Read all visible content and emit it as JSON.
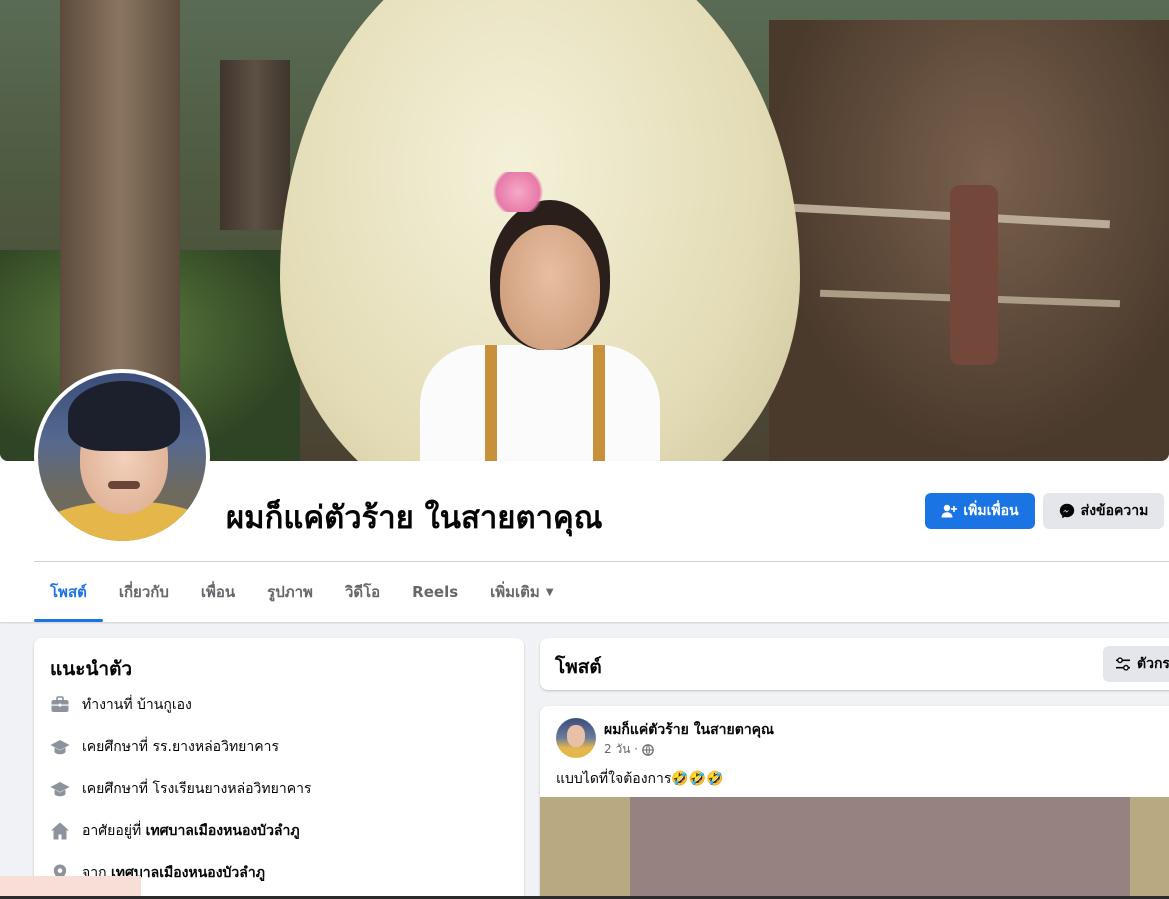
{
  "profile": {
    "name": "ผมก็แค่ตัวร้าย ในสายตาคุณ"
  },
  "actions": {
    "add_friend": "เพิ่มเพื่อน",
    "message": "ส่งข้อความ"
  },
  "tabs": [
    {
      "label": "โพสต์",
      "active": true
    },
    {
      "label": "เกี่ยวกับ"
    },
    {
      "label": "เพื่อน"
    },
    {
      "label": "รูปภาพ"
    },
    {
      "label": "วิดีโอ"
    },
    {
      "label": "Reels"
    },
    {
      "label": "เพิ่มเติม"
    }
  ],
  "intro": {
    "title": "แนะนำตัว",
    "items": [
      {
        "icon": "briefcase-icon",
        "prefix": "ทำงานที่ บ้านกูเอง",
        "bold": ""
      },
      {
        "icon": "graduation-cap-icon",
        "prefix": "เคยศึกษาที่ รร.ยางหล่อวิทยาคาร",
        "bold": ""
      },
      {
        "icon": "graduation-cap-icon",
        "prefix": "เคยศึกษาที่ โรงเรียนยางหล่อวิทยาคาร",
        "bold": ""
      },
      {
        "icon": "home-icon",
        "prefix": "อาศัยอยู่ที่ ",
        "bold": "เทศบาลเมืองหนองบัวลำภู"
      },
      {
        "icon": "location-pin-icon",
        "prefix": "จาก ",
        "bold": "เทศบาลเมืองหนองบัวลำภู"
      }
    ]
  },
  "posts": {
    "title": "โพสต์",
    "filter_label": "ตัวกรอง"
  },
  "post": {
    "author": "ผมก็แค่ตัวร้าย ในสายตาคุณ",
    "time": "2 วัน ·",
    "text": "แบบไดที่ใจต้องการ🤣🤣🤣"
  },
  "colors": {
    "primary": "#1b74e4",
    "secondary_bg": "#e4e6eb",
    "page_bg": "#f0f2f5",
    "muted_text": "#65676b"
  }
}
